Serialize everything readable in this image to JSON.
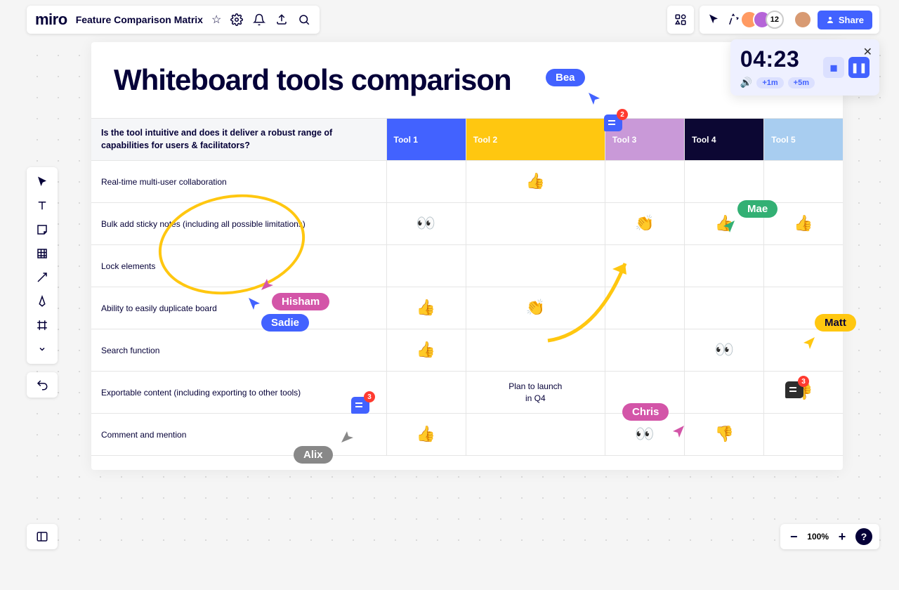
{
  "header": {
    "logo": "miro",
    "board_name": "Feature Comparison Matrix",
    "share": "Share",
    "collab_count": "12"
  },
  "timer": {
    "time": "04:23",
    "plus1": "+1m",
    "plus5": "+5m"
  },
  "board": {
    "title": "Whiteboard tools comparison",
    "question": "Is the tool intuitive and does it deliver a robust range of capabilities for users & facilitators?",
    "cols": [
      "Tool 1",
      "Tool 2",
      "Tool 3",
      "Tool 4",
      "Tool 5"
    ],
    "rows": [
      {
        "label": "Real-time multi-user collaboration",
        "cells": [
          "",
          "👍",
          "",
          "",
          ""
        ]
      },
      {
        "label": "Bulk add sticky notes (including all possible limitations)",
        "cells": [
          "👀",
          "",
          "👏",
          "👍",
          "👍"
        ]
      },
      {
        "label": "Lock elements",
        "cells": [
          "",
          "",
          "",
          "",
          ""
        ]
      },
      {
        "label": "Ability to easily duplicate board",
        "cells": [
          "👍",
          "👏",
          "",
          "",
          ""
        ]
      },
      {
        "label": "Search function",
        "cells": [
          "👍",
          "",
          "",
          "👀",
          ""
        ]
      },
      {
        "label": "Exportable content (including exporting to other tools)",
        "cells": [
          "",
          "Plan to launch in Q4",
          "",
          "",
          "👎"
        ]
      },
      {
        "label": "Comment and mention",
        "cells": [
          "👍",
          "",
          "👀",
          "👎",
          ""
        ]
      }
    ]
  },
  "cursors": {
    "bea": "Bea",
    "hisham": "Hisham",
    "sadie": "Sadie",
    "mae": "Mae",
    "matt": "Matt",
    "chris": "Chris",
    "alix": "Alix"
  },
  "comments": {
    "c1": "2",
    "c2": "3",
    "c3": "3"
  },
  "zoom": {
    "level": "100%"
  }
}
